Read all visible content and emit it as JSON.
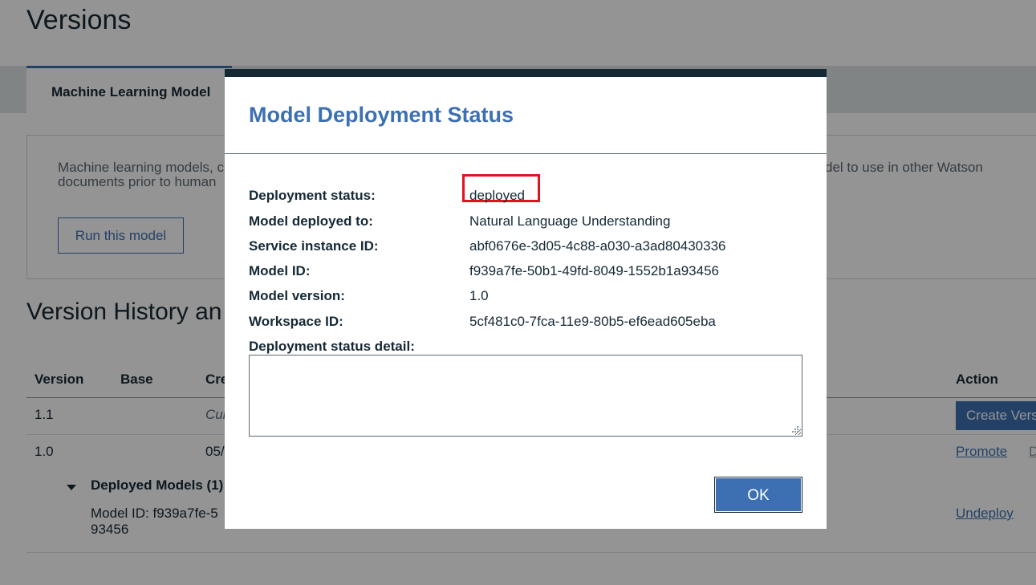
{
  "page": {
    "title": "Versions",
    "tab_label": "Machine Learning Model",
    "info_text_line1": "Machine learning models, c",
    "info_text_line2": "documents prior to human",
    "info_text_right": "del to use in other Watson",
    "run_button_label": "Run this model"
  },
  "history": {
    "section_title": "Version History an",
    "columns": [
      "Version",
      "Base",
      "Cre",
      "Action"
    ],
    "rows": [
      {
        "version": "1.1",
        "created": "Cur",
        "action_label": "Create Vers"
      },
      {
        "version": "1.0",
        "created": "05/",
        "action_label": "Promote",
        "action_extra": "D"
      }
    ],
    "deployed_models_label": "Deployed Models (1)",
    "deployed_model_line1": "Model ID: f939a7fe-5",
    "deployed_model_line2": "93456",
    "undeploy_label": "Undeploy"
  },
  "modal": {
    "title": "Model Deployment Status",
    "fields": [
      {
        "label": "Deployment status:",
        "value": "deployed"
      },
      {
        "label": "Model deployed to:",
        "value": "Natural Language Understanding"
      },
      {
        "label": "Service instance ID:",
        "value": "abf0676e-3d05-4c88-a030-a3ad80430336"
      },
      {
        "label": "Model ID:",
        "value": "f939a7fe-50b1-49fd-8049-1552b1a93456"
      },
      {
        "label": "Model version:",
        "value": "1.0"
      },
      {
        "label": "Workspace ID:",
        "value": "5cf481c0-7fca-11e9-80b5-ef6ead605eba"
      }
    ],
    "detail_label": "Deployment status detail:",
    "detail_value": "",
    "ok_label": "OK"
  },
  "colors": {
    "accent": "#3d70b2",
    "dark": "#152935",
    "highlight": "#e0131f"
  }
}
